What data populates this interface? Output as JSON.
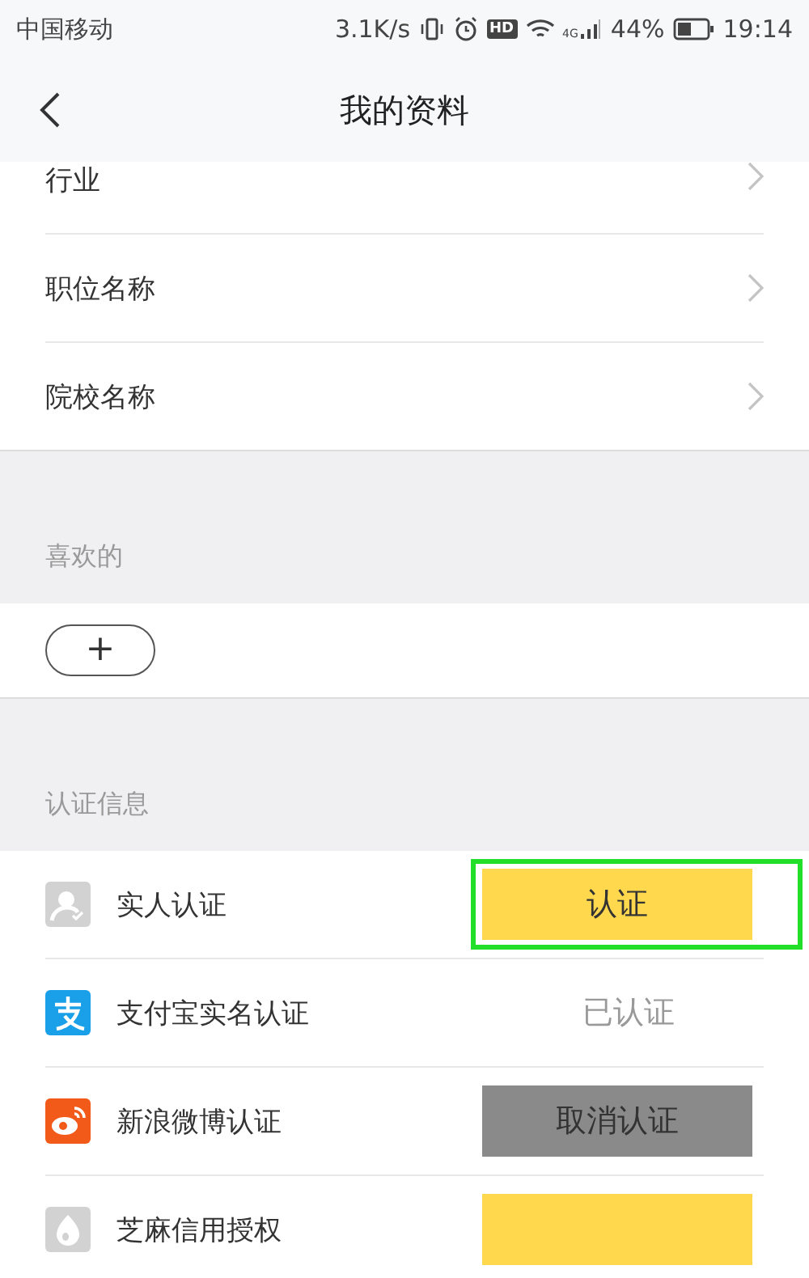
{
  "status_bar": {
    "carrier": "中国移动",
    "speed": "3.1K/s",
    "hd": "HD",
    "network": "4G",
    "battery": "44%",
    "time": "19:14"
  },
  "header": {
    "title": "我的资料"
  },
  "profile_fields": [
    {
      "label": "行业"
    },
    {
      "label": "职位名称"
    },
    {
      "label": "院校名称"
    }
  ],
  "likes": {
    "heading": "喜欢的",
    "add_button": "+"
  },
  "verification": {
    "heading": "认证信息",
    "items": [
      {
        "label": "实人认证",
        "action": {
          "kind": "button",
          "label": "认证",
          "color": "#ffd84d",
          "highlighted": true
        }
      },
      {
        "label": "支付宝实名认证",
        "action": {
          "kind": "status",
          "label": "已认证"
        }
      },
      {
        "label": "新浪微博认证",
        "action": {
          "kind": "button",
          "label": "取消认证",
          "color": "#8a8a8a",
          "highlighted": false
        }
      },
      {
        "label": "芝麻信用授权",
        "action": {
          "kind": "button",
          "color": "#ffd84d",
          "highlighted": false
        }
      }
    ]
  }
}
